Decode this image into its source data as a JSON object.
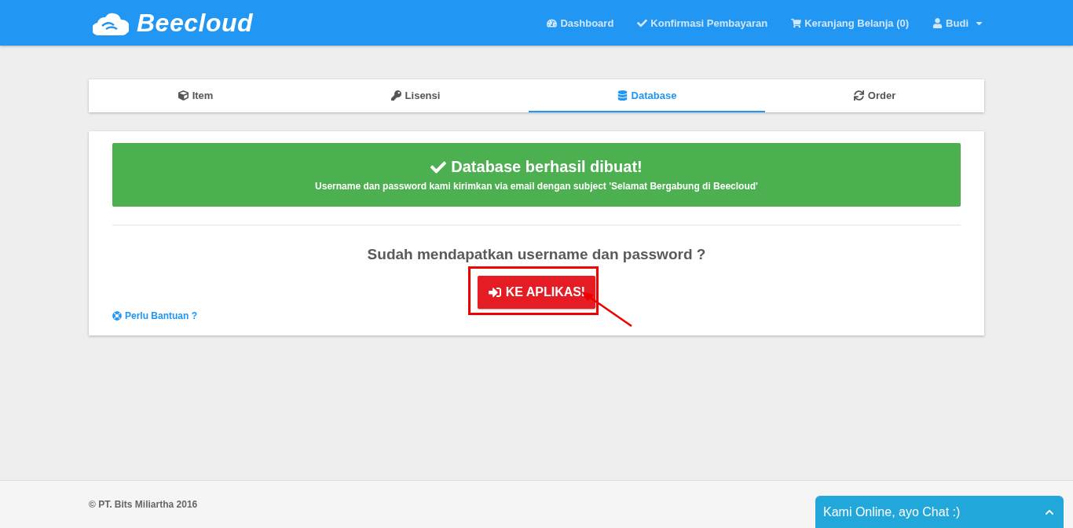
{
  "brand": "Beecloud",
  "nav": [
    {
      "kind": "dashboard",
      "label": "Dashboard"
    },
    {
      "kind": "confirm",
      "label": "Konfirmasi Pembayaran"
    },
    {
      "kind": "cart",
      "label": "Keranjang Belanja (0)"
    },
    {
      "kind": "user",
      "label": "Budi"
    }
  ],
  "tabs": [
    {
      "kind": "item",
      "label": "Item",
      "selected": false
    },
    {
      "kind": "license",
      "label": "Lisensi",
      "selected": false
    },
    {
      "kind": "database",
      "label": "Database",
      "selected": true
    },
    {
      "kind": "order",
      "label": "Order",
      "selected": false
    }
  ],
  "alert": {
    "title": "Database berhasil dibuat!",
    "message": "Username dan password kami kirimkan via email dengan subject 'Selamat Bergabung di Beecloud'"
  },
  "question": "Sudah mendapatkan username dan password ?",
  "app_button": "KE APLIKASI",
  "help_link": "Perlu Bantuan ?",
  "footer": "© PT. Bits Miliartha 2016",
  "chat": {
    "label": "Kami Online, ayo Chat :)"
  }
}
